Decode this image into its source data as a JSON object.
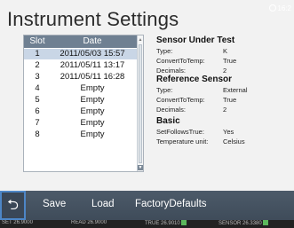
{
  "title": "Instrument Settings",
  "status": {
    "time": "16:2"
  },
  "slots": {
    "headers": {
      "slot": "Slot",
      "date": "Date"
    },
    "rows": [
      {
        "slot": "1",
        "date": "2011/05/03 15:57",
        "selected": true
      },
      {
        "slot": "2",
        "date": "2011/05/11 13:17"
      },
      {
        "slot": "3",
        "date": "2011/05/11 16:28"
      },
      {
        "slot": "4",
        "date": "Empty"
      },
      {
        "slot": "5",
        "date": "Empty"
      },
      {
        "slot": "6",
        "date": "Empty"
      },
      {
        "slot": "7",
        "date": "Empty"
      },
      {
        "slot": "8",
        "date": "Empty"
      }
    ]
  },
  "sensor_under_test": {
    "title": "Sensor Under Test",
    "fields": [
      {
        "key": "Type:",
        "value": "K"
      },
      {
        "key": "ConvertToTemp:",
        "value": "True"
      },
      {
        "key": "Decimals:",
        "value": "2"
      }
    ]
  },
  "reference_sensor": {
    "title": "Reference Sensor",
    "fields": [
      {
        "key": "Type:",
        "value": "External"
      },
      {
        "key": "ConvertToTemp:",
        "value": "True"
      },
      {
        "key": "Decimals:",
        "value": "2"
      }
    ]
  },
  "basic": {
    "title": "Basic",
    "fields": [
      {
        "key": "SetFollowsTrue:",
        "value": "Yes"
      },
      {
        "key": "Temperature unit:",
        "value": "Celsius"
      }
    ]
  },
  "toolbar": {
    "back_icon": "⮌",
    "save": "Save",
    "load": "Load",
    "factory_defaults": "FactoryDefaults"
  },
  "readings": [
    {
      "label": "SET",
      "value": "26.9000"
    },
    {
      "label": "READ",
      "value": "26.9000"
    },
    {
      "label": "TRUE",
      "value": "26.9010"
    },
    {
      "label": "SENSOR",
      "value": "26.3380"
    }
  ],
  "colors": {
    "table_header": "#6f8092",
    "selected_row": "#c9d6e6",
    "toolbar": "#44515f",
    "back_focus": "#4d86c7",
    "reading_ok": "#5cb85c"
  }
}
